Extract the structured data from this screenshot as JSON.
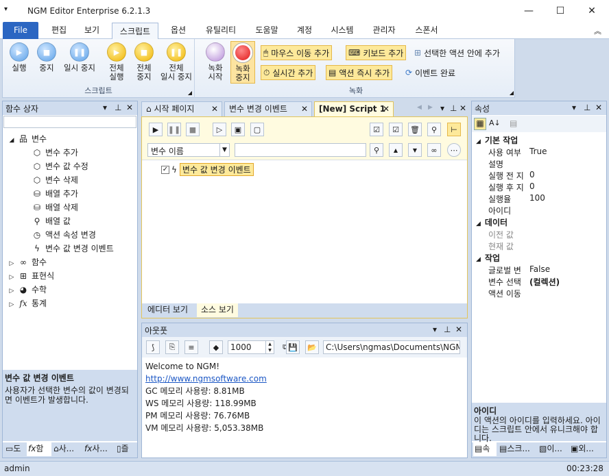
{
  "app": {
    "title": "NGM Editor  Enterprise 6.2.1.3"
  },
  "menu": {
    "file": "File",
    "items": [
      "편집",
      "보기",
      "스크립트",
      "옵션",
      "유틸리티",
      "도움말",
      "계정",
      "시스템",
      "관리자",
      "스폰서"
    ],
    "active": "스크립트"
  },
  "ribbon": {
    "script_group": "스크립트",
    "record_group": "녹화",
    "run": "실행",
    "stop": "중지",
    "pause": "일시 중지",
    "run_all_1": "전체",
    "run_all_2": "실행",
    "stop_all_1": "전체",
    "stop_all_2": "중지",
    "pause_all_1": "전체",
    "pause_all_2": "일시 중지",
    "rec_start_1": "녹화",
    "rec_start_2": "시작",
    "rec_stop_1": "녹화",
    "rec_stop_2": "중지",
    "mouse_move": "마우스 이동 추가",
    "keyboard": "키보드 추가",
    "add_in_selected": "선택한 액션 안에 추가",
    "realtime": "실시간 추가",
    "immediate": "액션 즉시 추가",
    "event_done": "이벤트 완료"
  },
  "left_panel": {
    "title": "함수 상자",
    "tree": {
      "root": "변수",
      "items": [
        "변수 추가",
        "변수 값 수정",
        "변수 삭제",
        "배열 추가",
        "배열 삭제",
        "배열 값",
        "액션 속성 변경",
        "변수 값 변경 이벤트"
      ],
      "others": [
        "함수",
        "표현식",
        "수학",
        "통계"
      ]
    },
    "desc_title": "변수 값 변경 이벤트",
    "desc_text": "사용자가 선택한 변수의 값이 변경되면 이벤트가 발생합니다.",
    "bottom_tabs": [
      "도",
      "함",
      "사...",
      "사...",
      "즐"
    ]
  },
  "doc_tabs": [
    "시작 페이지",
    "변수 변경 이벤트",
    "[New] Script 1"
  ],
  "editor": {
    "filter_select": "변수 이름",
    "search_value": "",
    "item": "변수 값 변경 이벤트",
    "view_tabs": [
      "에디터 보기",
      "소스 보기"
    ]
  },
  "output": {
    "title": "아웃풋",
    "count": "1000",
    "path": "C:\\Users\\ngmas\\Documents\\NGM6\\",
    "lines": [
      "Welcome to NGM!",
      "http://www.ngmsoftware.com",
      "GC 메모리 사용량: 8.81MB",
      "WS 메모리 사용량: 118.99MB",
      "PM 메모리 사용량: 76.76MB",
      "VM 메모리 사용량: 5,053.38MB"
    ]
  },
  "props": {
    "title": "속성",
    "cat1": "기본 작업",
    "r1k": "사용 여부",
    "r1v": "True",
    "r2k": "설명",
    "r2v": "",
    "r3k": "실행 전 지",
    "r3v": "0",
    "r4k": "실행 후 지",
    "r4v": "0",
    "r5k": "실행율",
    "r5v": "100",
    "r6k": "아이디",
    "r6v": "",
    "cat2": "데이터",
    "r7k": "이전 값",
    "r8k": "현재 값",
    "cat3": "작업",
    "r9k": "글로벌 변",
    "r9v": "False",
    "r10k": "변수 선택",
    "r10v": "(컬렉션)",
    "r11k": "액션 이동",
    "r11v": "",
    "desc_title": "아이디",
    "desc_text": "이 액션의 아이디를 입력하세요. 아이디는 스크립트 안에서 유니크해야 합니다.",
    "bottom_tabs": [
      "속",
      "스크...",
      "이...",
      "외..."
    ]
  },
  "status": {
    "user": "admin",
    "time": "00:23:28"
  }
}
